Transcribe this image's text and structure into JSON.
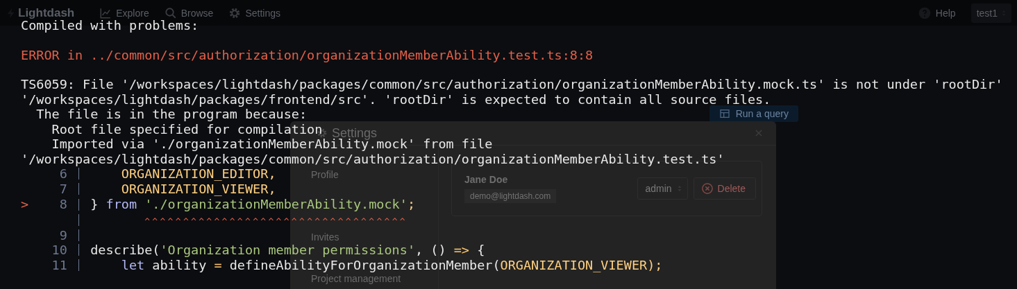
{
  "app": {
    "brand": "Lightdash",
    "nav": [
      {
        "label": "Explore"
      },
      {
        "label": "Browse"
      },
      {
        "label": "Settings"
      }
    ],
    "help": "Help",
    "project": "test1",
    "run_button": "Run a query"
  },
  "settings_modal": {
    "title": "Settings",
    "menu": [
      {
        "label": "Profile"
      },
      {
        "label": "Invites"
      },
      {
        "label": "Project management"
      }
    ],
    "member": {
      "name": "Jane Doe",
      "email": "demo@lightdash.com",
      "role": "admin",
      "delete_label": "Delete"
    }
  },
  "error_overlay": {
    "title": "Compiled with problems:",
    "error": "ERROR in ../common/src/authorization/organizationMemberAbility.test.ts:8:8",
    "message": [
      {
        "kind": "text",
        "text": "TS6059: File '/workspaces/lightdash/packages/common/src/authorization/organizationMemberAbility.mock.ts' is not under 'rootDir'"
      },
      {
        "kind": "text",
        "text": "'/workspaces/lightdash/packages/frontend/src'. 'rootDir' is expected to contain all source files."
      },
      {
        "kind": "note",
        "text": "The file is in the program because:"
      },
      {
        "kind": "item",
        "text": "Root file specified for compilation"
      },
      {
        "kind": "item",
        "text": "Imported via './organizationMemberAbility.mock' from file"
      },
      {
        "kind": "text",
        "text": "'/workspaces/lightdash/packages/common/src/authorization/organizationMemberAbility.test.ts'"
      }
    ],
    "code_frame": [
      {
        "kind": "code",
        "number": "6",
        "marked": false,
        "indented": true,
        "tokens": [
          {
            "kind": "constant",
            "text": "ORGANIZATION_EDITOR,"
          }
        ]
      },
      {
        "kind": "code",
        "number": "7",
        "marked": false,
        "indented": true,
        "tokens": [
          {
            "kind": "constant",
            "text": "ORGANIZATION_VIEWER,"
          }
        ]
      },
      {
        "kind": "code",
        "number": "8",
        "marked": true,
        "marker": ">",
        "indented": false,
        "tokens": [
          {
            "kind": "plain",
            "text": "} "
          },
          {
            "kind": "keyword",
            "text": "from "
          },
          {
            "kind": "string",
            "text": "'./organizationMemberAbility.mock'"
          },
          {
            "kind": "constant",
            "text": ";"
          }
        ]
      },
      {
        "kind": "pointer",
        "text": "^^^^^^^^^^^^^^^^^^^^^^^^^^^^^^^^^^"
      },
      {
        "kind": "code",
        "number": "9",
        "marked": false
      },
      {
        "kind": "code",
        "number": "10",
        "marked": false,
        "indented": false,
        "tokens": [
          {
            "kind": "plain",
            "text": "describe("
          },
          {
            "kind": "string",
            "text": "'Organization member permissions'"
          },
          {
            "kind": "plain",
            "text": ", () "
          },
          {
            "kind": "operator",
            "text": "=>"
          },
          {
            "kind": "plain",
            "text": " {"
          }
        ]
      },
      {
        "kind": "code",
        "number": "11",
        "marked": false,
        "indented": true,
        "tokens": [
          {
            "kind": "keyword",
            "text": "let"
          },
          {
            "kind": "plain",
            "text": " ability "
          },
          {
            "kind": "operator",
            "text": "="
          },
          {
            "kind": "plain",
            "text": " defineAbilityForOrganizationMember("
          },
          {
            "kind": "constant",
            "text": "ORGANIZATION_VIEWER);"
          }
        ]
      }
    ]
  }
}
